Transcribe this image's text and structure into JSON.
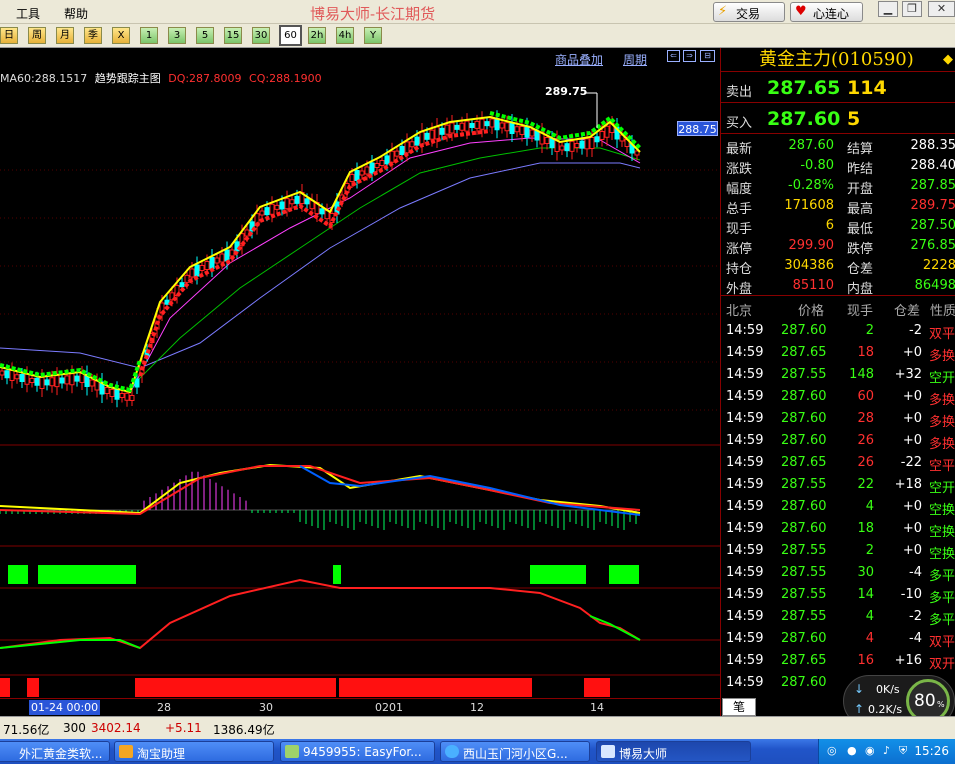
{
  "menubar": {
    "items": [
      "工具",
      "帮助"
    ],
    "title": "博易大师-长江期货",
    "trade_button": "交易",
    "heart_button": "心连心"
  },
  "toolbar": {
    "buttons": [
      "日",
      "周",
      "月",
      "季",
      "X",
      "1",
      "3",
      "5",
      "15",
      "30",
      "60",
      "2h",
      "4h",
      "Y"
    ],
    "selected": "60"
  },
  "chart": {
    "header_links": [
      "商品叠加",
      "周期"
    ],
    "legend": {
      "ma60": "MA60:288.1517",
      "name": "趋势跟踪主图",
      "dq": "DQ:287.8009",
      "cq": "CQ:288.1900"
    },
    "high_label": "289.75",
    "last_price_tag": "288.75",
    "x_labels": [
      "01-24 00:00",
      "28",
      "30",
      "0201",
      "12",
      "14"
    ],
    "colors": {
      "up": "#ff2020",
      "down": "#00ffff",
      "ma60": "#7b7bff",
      "fast": "#ffff00",
      "signal_green": "#00ff00"
    }
  },
  "quote": {
    "name": "黄金主力(010590)",
    "sell": {
      "label": "卖出",
      "price": "287.65",
      "vol": "114"
    },
    "buy": {
      "label": "买入",
      "price": "287.60",
      "vol": "5"
    },
    "stats": [
      {
        "l1": "最新",
        "v1": "287.60",
        "c1": "#39ff14",
        "l2": "结算",
        "v2": "288.35",
        "c2": "#fff"
      },
      {
        "l1": "涨跌",
        "v1": "-0.80",
        "c1": "#39ff14",
        "l2": "昨结",
        "v2": "288.40",
        "c2": "#fff"
      },
      {
        "l1": "幅度",
        "v1": "-0.28%",
        "c1": "#39ff14",
        "l2": "开盘",
        "v2": "287.85",
        "c2": "#39ff14"
      },
      {
        "l1": "总手",
        "v1": "171608",
        "c1": "#ffd800",
        "l2": "最高",
        "v2": "289.75",
        "c2": "#ff3030"
      },
      {
        "l1": "现手",
        "v1": "6",
        "c1": "#ffd800",
        "l2": "最低",
        "v2": "287.50",
        "c2": "#39ff14"
      },
      {
        "l1": "涨停",
        "v1": "299.90",
        "c1": "#ff3030",
        "l2": "跌停",
        "v2": "276.85",
        "c2": "#39ff14"
      },
      {
        "l1": "持仓",
        "v1": "304386",
        "c1": "#ffd800",
        "l2": "仓差",
        "v2": "2228",
        "c2": "#ffd800"
      },
      {
        "l1": "外盘",
        "v1": "85110",
        "c1": "#ff3030",
        "l2": "内盘",
        "v2": "86498",
        "c2": "#39ff14"
      }
    ],
    "ticks_header": [
      "北京",
      "价格",
      "现手",
      "仓差",
      "性质"
    ],
    "ticks": [
      {
        "time": "14:59",
        "price": "287.60",
        "vol": "2",
        "vc": "#39ff14",
        "delta": "-2",
        "kind": "双平",
        "kc": "#ff3030"
      },
      {
        "time": "14:59",
        "price": "287.65",
        "vol": "18",
        "vc": "#ff3030",
        "delta": "+0",
        "kind": "多换",
        "kc": "#ff3030"
      },
      {
        "time": "14:59",
        "price": "287.55",
        "vol": "148",
        "vc": "#39ff14",
        "delta": "+32",
        "kind": "空开",
        "kc": "#39ff14"
      },
      {
        "time": "14:59",
        "price": "287.60",
        "vol": "60",
        "vc": "#ff3030",
        "delta": "+0",
        "kind": "多换",
        "kc": "#ff3030"
      },
      {
        "time": "14:59",
        "price": "287.60",
        "vol": "28",
        "vc": "#ff3030",
        "delta": "+0",
        "kind": "多换",
        "kc": "#ff3030"
      },
      {
        "time": "14:59",
        "price": "287.60",
        "vol": "26",
        "vc": "#ff3030",
        "delta": "+0",
        "kind": "多换",
        "kc": "#ff3030"
      },
      {
        "time": "14:59",
        "price": "287.65",
        "vol": "26",
        "vc": "#ff3030",
        "delta": "-22",
        "kind": "空平",
        "kc": "#ff3030"
      },
      {
        "time": "14:59",
        "price": "287.55",
        "vol": "22",
        "vc": "#39ff14",
        "delta": "+18",
        "kind": "空开",
        "kc": "#39ff14"
      },
      {
        "time": "14:59",
        "price": "287.60",
        "vol": "4",
        "vc": "#39ff14",
        "delta": "+0",
        "kind": "空换",
        "kc": "#39ff14"
      },
      {
        "time": "14:59",
        "price": "287.60",
        "vol": "18",
        "vc": "#39ff14",
        "delta": "+0",
        "kind": "空换",
        "kc": "#39ff14"
      },
      {
        "time": "14:59",
        "price": "287.55",
        "vol": "2",
        "vc": "#39ff14",
        "delta": "+0",
        "kind": "空换",
        "kc": "#39ff14"
      },
      {
        "time": "14:59",
        "price": "287.55",
        "vol": "30",
        "vc": "#39ff14",
        "delta": "-4",
        "kind": "多平",
        "kc": "#39ff14"
      },
      {
        "time": "14:59",
        "price": "287.55",
        "vol": "14",
        "vc": "#39ff14",
        "delta": "-10",
        "kind": "多平",
        "kc": "#39ff14"
      },
      {
        "time": "14:59",
        "price": "287.55",
        "vol": "4",
        "vc": "#39ff14",
        "delta": "-2",
        "kind": "多平",
        "kc": "#39ff14"
      },
      {
        "time": "14:59",
        "price": "287.60",
        "vol": "4",
        "vc": "#ff3030",
        "delta": "-4",
        "kind": "双平",
        "kc": "#ff3030"
      },
      {
        "time": "14:59",
        "price": "287.65",
        "vol": "16",
        "vc": "#ff3030",
        "delta": "+16",
        "kind": "双开",
        "kc": "#ff3030"
      },
      {
        "time": "14:59",
        "price": "287.60",
        "vol": "",
        "vc": "#39ff14",
        "delta": "",
        "kind": "",
        "kc": "#39ff14"
      }
    ],
    "tab_label": "笔"
  },
  "widget": {
    "down": "0K/s",
    "up": "0.2K/s",
    "percent": "80"
  },
  "status": {
    "s1": "71.56亿",
    "s2": "300",
    "s3": "3402.14",
    "s4": "+5.11",
    "s5": "1386.49亿"
  },
  "taskbar": {
    "items": [
      "外汇黄金类软...",
      "淘宝助理",
      "9459955: EasyFor...",
      "西山玉门河小区G...",
      "博易大师"
    ],
    "clock": "15:26"
  }
}
